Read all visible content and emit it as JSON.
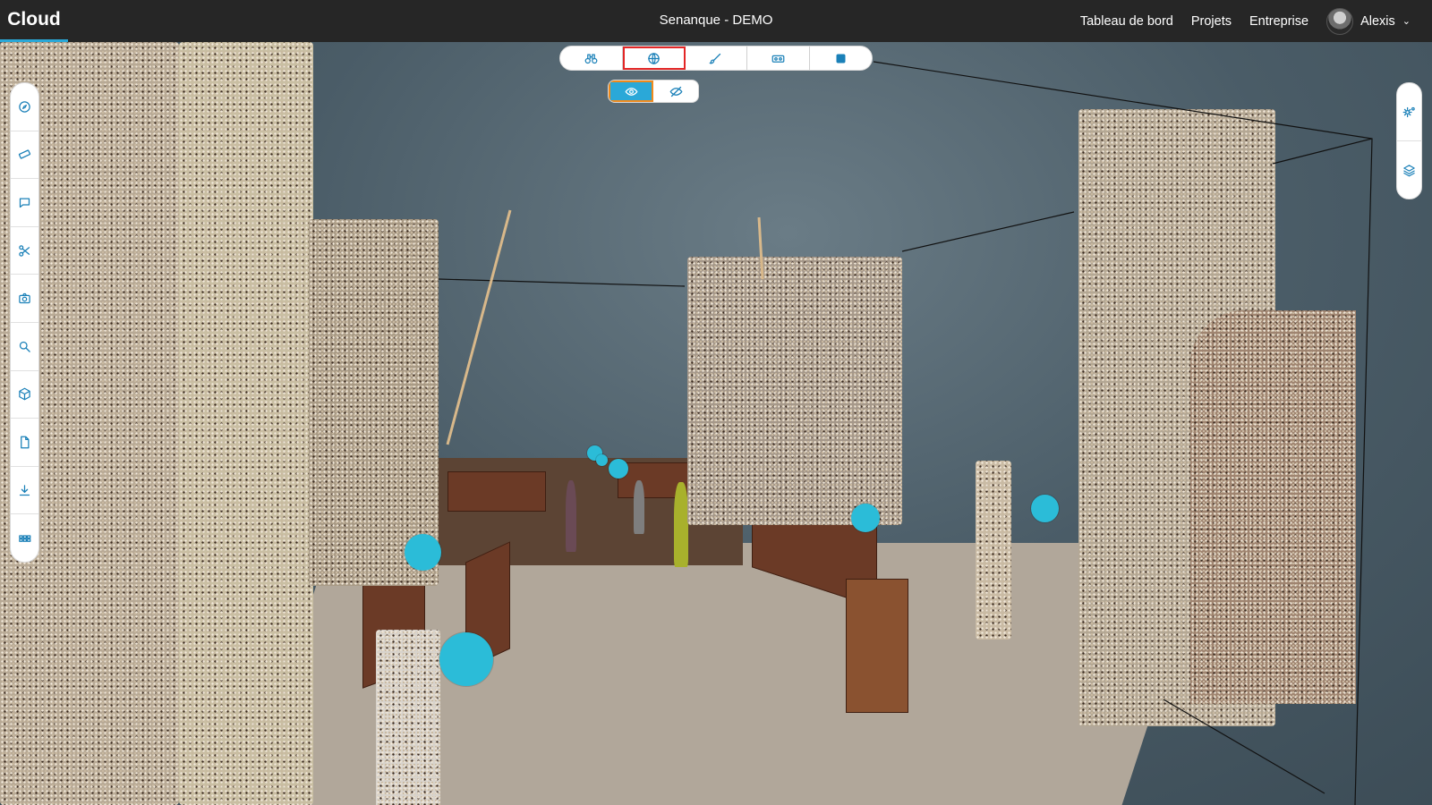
{
  "app": {
    "brand": "Cloud",
    "title": "Senanque - DEMO"
  },
  "nav": {
    "dashboard": "Tableau de bord",
    "projects": "Projets",
    "company": "Entreprise",
    "user": "Alexis"
  },
  "toolbar": {
    "tools": [
      "binoculars-icon",
      "globe-icon",
      "brush-icon",
      "vr-headset-icon",
      "square-icon"
    ],
    "active": "globe-icon",
    "subtools": [
      "eye-icon",
      "eye-off-icon"
    ],
    "subactive": "eye-icon"
  },
  "left_toolbar": [
    "compass-icon",
    "ruler-icon",
    "comment-icon",
    "scissors-icon",
    "camera-icon",
    "search-icon",
    "cube-icon",
    "file-icon",
    "download-icon",
    "grid-icon"
  ],
  "right_toolbar": [
    "settings-icon",
    "layers-icon"
  ],
  "colors": {
    "topbar": "#262626",
    "accent": "#2aa8d8",
    "marker": "#2bbcd8",
    "active_outline": "#e32626",
    "subactive_outline": "#f08a1c"
  }
}
